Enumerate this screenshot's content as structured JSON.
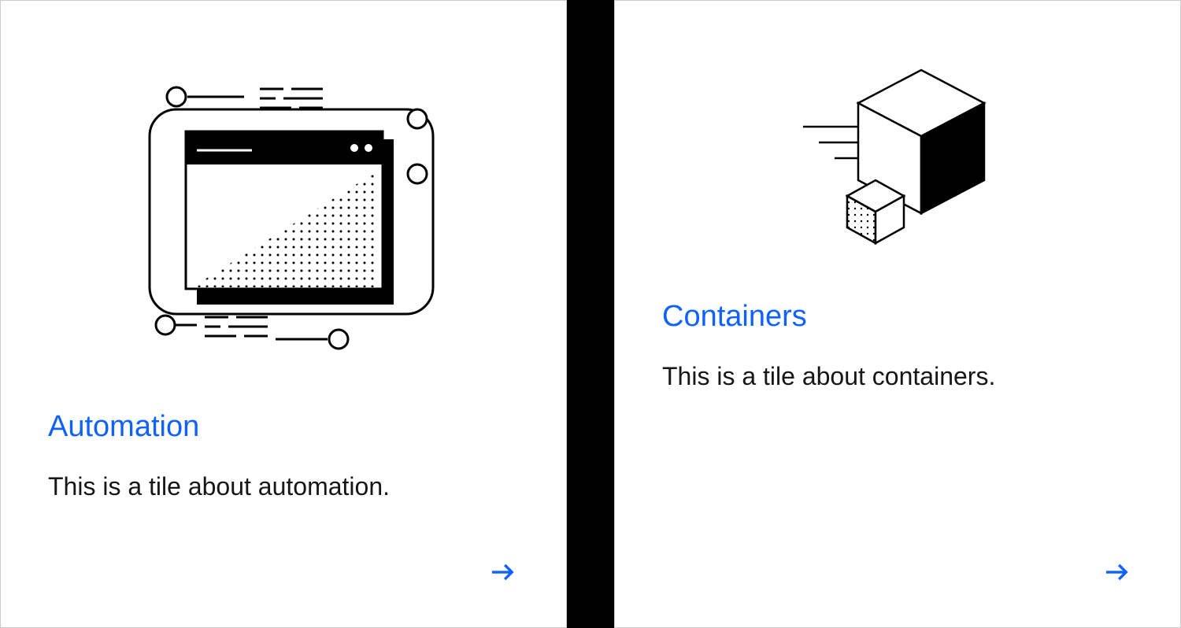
{
  "tiles": [
    {
      "title": "Automation",
      "description": "This is a tile about automation.",
      "icon": "automation-illustration"
    },
    {
      "title": "Containers",
      "description": "This is a tile about containers.",
      "icon": "containers-illustration"
    }
  ],
  "colors": {
    "link": "#0f62fe",
    "text": "#161616",
    "border": "#cccccc"
  }
}
